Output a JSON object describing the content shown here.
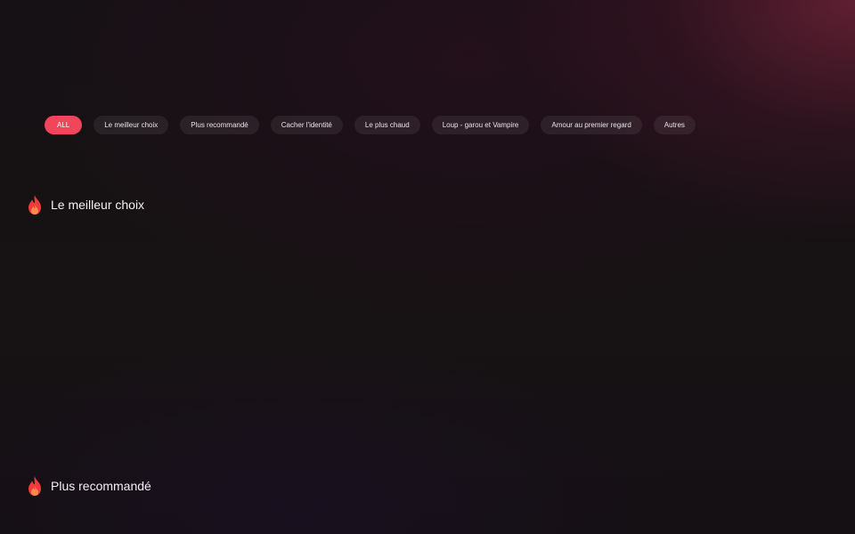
{
  "categories": {
    "active_index": 0,
    "items": [
      {
        "label": "ALL"
      },
      {
        "label": "Le meilleur choix"
      },
      {
        "label": "Plus recommandé"
      },
      {
        "label": "Cacher l'identité"
      },
      {
        "label": "Le plus chaud"
      },
      {
        "label": "Loup - garou et Vampire"
      },
      {
        "label": "Amour au premier regard"
      },
      {
        "label": "Autres"
      }
    ]
  },
  "sections": [
    {
      "title": "Le meilleur choix",
      "icon": "flame-icon"
    },
    {
      "title": "Plus recommandé",
      "icon": "flame-icon"
    }
  ],
  "colors": {
    "accent": "#f2455b",
    "background": "#141012",
    "flame_outer": "#ef3b3b",
    "flame_inner": "#ff8a4c"
  }
}
